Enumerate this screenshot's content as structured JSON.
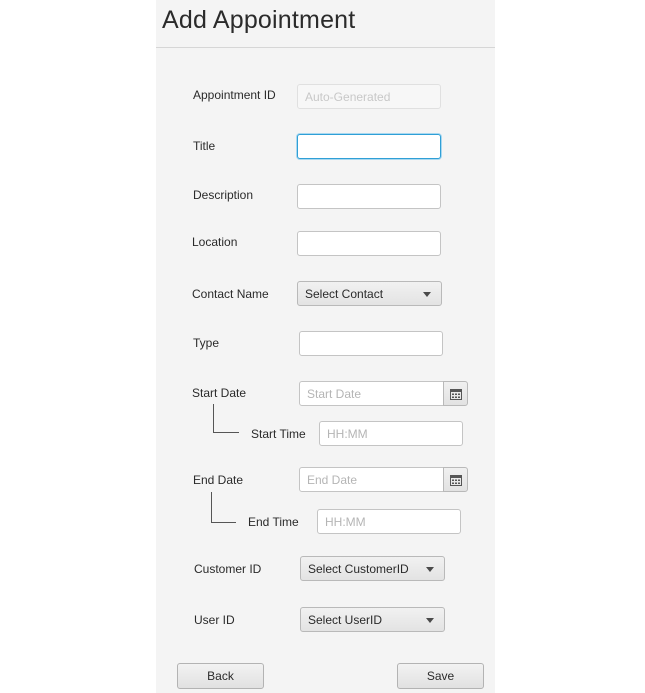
{
  "header": {
    "title": "Add Appointment"
  },
  "form": {
    "appointment_id": {
      "label": "Appointment ID",
      "placeholder": "Auto-Generated",
      "value": ""
    },
    "title": {
      "label": "Title",
      "value": ""
    },
    "description": {
      "label": "Description",
      "value": ""
    },
    "location": {
      "label": "Location",
      "value": ""
    },
    "contact_name": {
      "label": "Contact Name",
      "selected": "Select Contact"
    },
    "type": {
      "label": "Type",
      "value": ""
    },
    "start_date": {
      "label": "Start Date",
      "placeholder": "Start Date"
    },
    "start_time": {
      "label": "Start Time",
      "placeholder": "HH:MM"
    },
    "end_date": {
      "label": "End Date",
      "placeholder": "End Date"
    },
    "end_time": {
      "label": "End Time",
      "placeholder": "HH:MM"
    },
    "customer_id": {
      "label": "Customer ID",
      "selected": "Select CustomerID"
    },
    "user_id": {
      "label": "User ID",
      "selected": "Select UserID"
    }
  },
  "actions": {
    "back_label": "Back",
    "save_label": "Save"
  },
  "icons": {
    "date_picker": "calendar-icon",
    "dropdown": "chevron-down-icon"
  },
  "colors": {
    "focus_border": "#2f9fd6",
    "panel_background": "#f4f4f4"
  }
}
